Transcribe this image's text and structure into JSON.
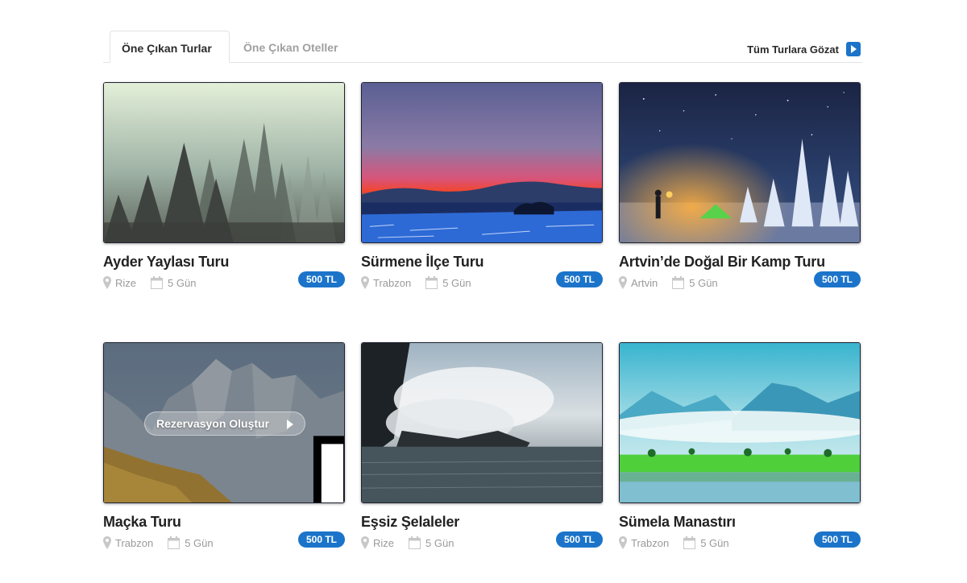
{
  "tabs": {
    "active": "Öne Çıkan Turlar",
    "inactive": "Öne Çıkan Oteller",
    "browse_all": "Tüm Turlara Gözat"
  },
  "colors": {
    "accent": "#1b74c9"
  },
  "reserve_label": "Rezervasyon Oluştur",
  "tours": [
    {
      "title": "Ayder Yaylası Turu",
      "location": "Rize",
      "duration": "5 Gün",
      "price": "500 TL"
    },
    {
      "title": "Sürmene İlçe Turu",
      "location": "Trabzon",
      "duration": "5 Gün",
      "price": "500 TL"
    },
    {
      "title": "Artvin’de Doğal Bir Kamp Turu",
      "location": "Artvin",
      "duration": "5 Gün",
      "price": "500 TL"
    },
    {
      "title": "Maçka Turu",
      "location": "Trabzon",
      "duration": "5 Gün",
      "price": "500 TL"
    },
    {
      "title": "Eşsiz Şelaleler",
      "location": "Rize",
      "duration": "5 Gün",
      "price": "500 TL"
    },
    {
      "title": "Sümela Manastırı",
      "location": "Trabzon",
      "duration": "5 Gün",
      "price": "500 TL"
    }
  ]
}
